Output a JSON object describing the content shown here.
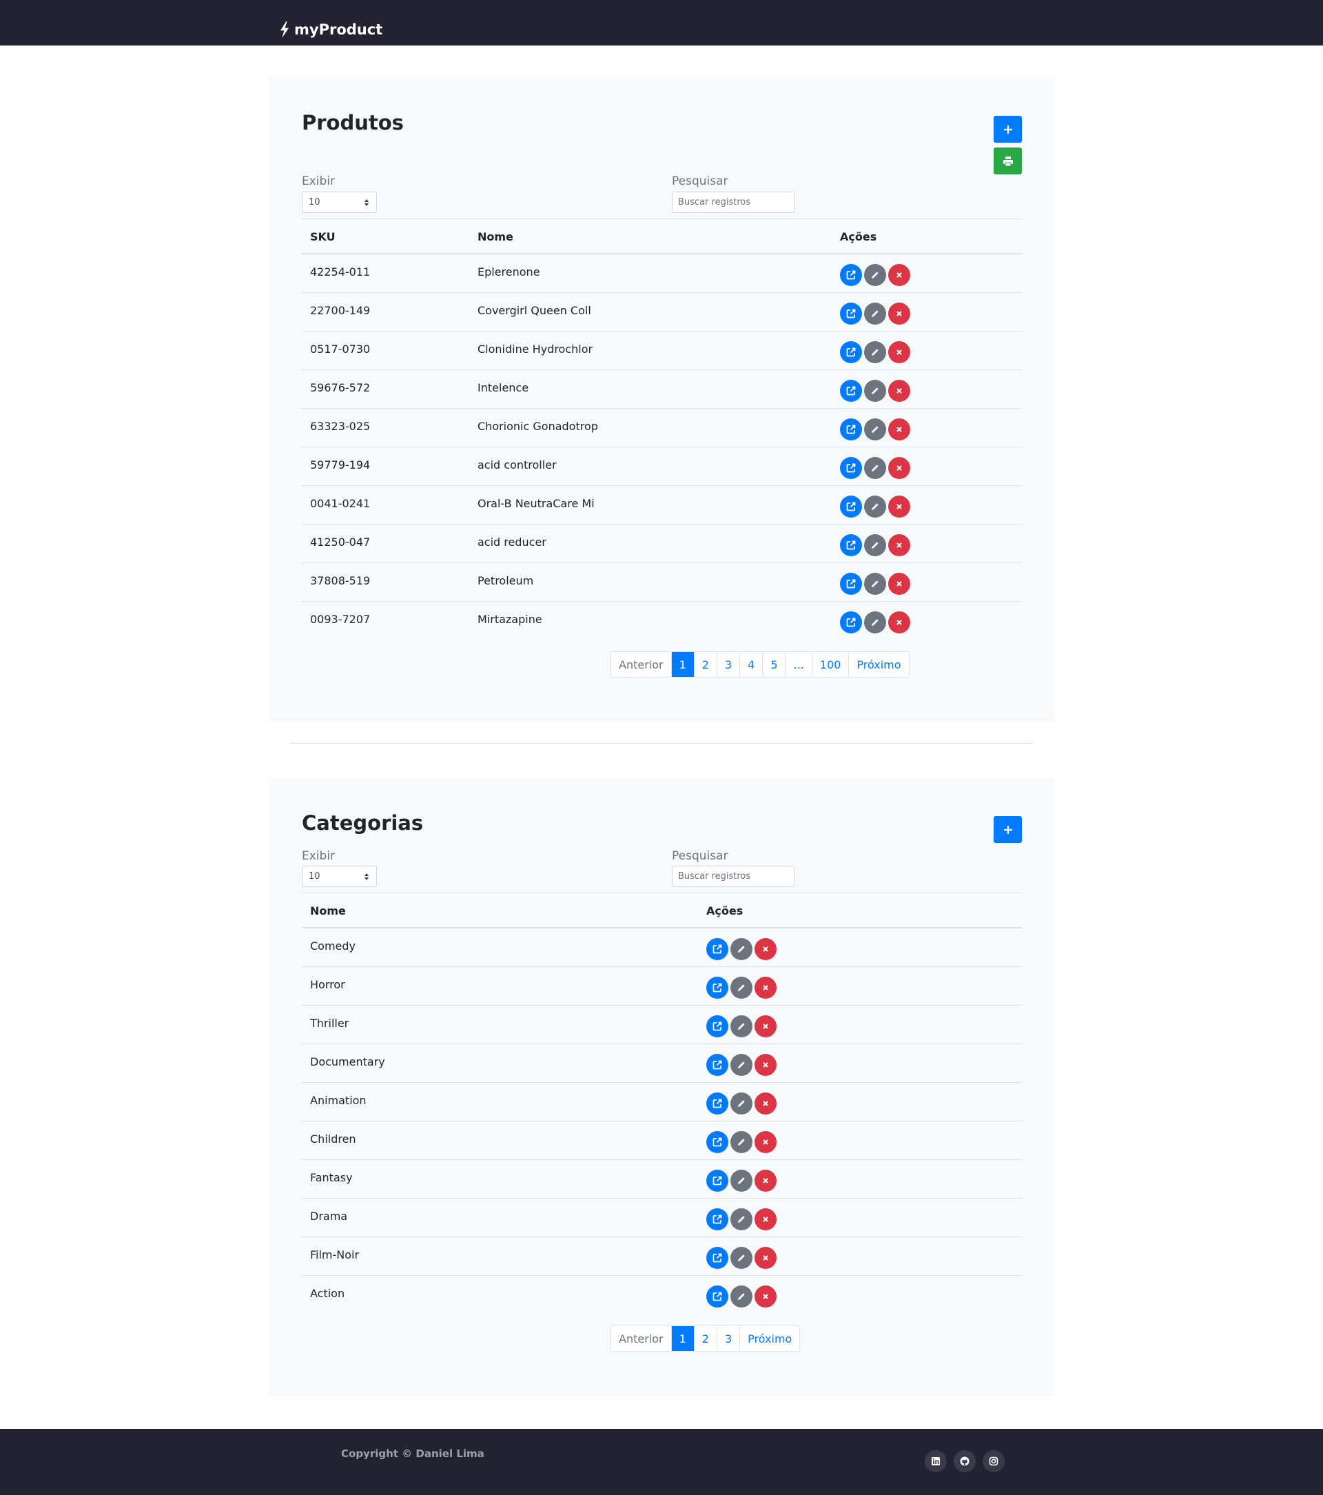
{
  "header": {
    "brand": "myProduct"
  },
  "colors": {
    "primary": "#007bff",
    "success": "#28a745",
    "secondary": "#6c757d",
    "danger": "#dc3545",
    "navbar": "#222231"
  },
  "produtos": {
    "title": "Produtos",
    "add_icon": "plus-icon",
    "print_icon": "print-icon",
    "show_label": "Exibir",
    "show_value": "10",
    "search_label": "Pesquisar",
    "search_placeholder": "Buscar registros",
    "columns": [
      "SKU",
      "Nome",
      "Ações"
    ],
    "rows": [
      {
        "sku": "42254-011",
        "nome": "Eplerenone"
      },
      {
        "sku": "22700-149",
        "nome": "Covergirl Queen Coll"
      },
      {
        "sku": "0517-0730",
        "nome": "Clonidine Hydrochlor"
      },
      {
        "sku": "59676-572",
        "nome": "Intelence"
      },
      {
        "sku": "63323-025",
        "nome": "Chorionic Gonadotrop"
      },
      {
        "sku": "59779-194",
        "nome": "acid controller"
      },
      {
        "sku": "0041-0241",
        "nome": "Oral-B NeutraCare Mi"
      },
      {
        "sku": "41250-047",
        "nome": "acid reducer"
      },
      {
        "sku": "37808-519",
        "nome": "Petroleum"
      },
      {
        "sku": "0093-7207",
        "nome": "Mirtazapine"
      }
    ],
    "pagination": [
      "Anterior",
      "1",
      "2",
      "3",
      "4",
      "5",
      "...",
      "100",
      "Próximo"
    ]
  },
  "categorias": {
    "title": "Categorias",
    "add_icon": "plus-icon",
    "show_label": "Exibir",
    "show_value": "10",
    "search_label": "Pesquisar",
    "search_placeholder": "Buscar registros",
    "columns": [
      "Nome",
      "Ações"
    ],
    "rows": [
      "Comedy",
      "Horror",
      "Thriller",
      "Documentary",
      "Animation",
      "Children",
      "Fantasy",
      "Drama",
      "Film-Noir",
      "Action"
    ],
    "pagination": [
      "Anterior",
      "1",
      "2",
      "3",
      "Próximo"
    ]
  },
  "footer": {
    "copyright": "Copyright © Daniel Lima",
    "social": [
      "linkedin-icon",
      "github-icon",
      "instagram-icon"
    ]
  }
}
